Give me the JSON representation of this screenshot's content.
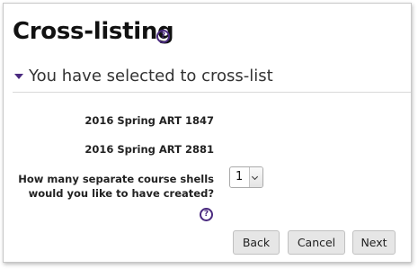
{
  "page": {
    "title": "Cross-listing",
    "title_help_icon": "question-circle-icon"
  },
  "section": {
    "title": "You have selected to cross-list",
    "toggle_icon": "caret-down-icon"
  },
  "selected_courses": [
    "2016 Spring ART 1847",
    "2016 Spring ART 2881"
  ],
  "shells_question": {
    "label": "How many separate course shells would you like to have created?",
    "help_icon": "question-circle-icon",
    "selected_value": "1"
  },
  "buttons": {
    "back": "Back",
    "cancel": "Cancel",
    "next": "Next"
  },
  "colors": {
    "accent": "#4a2a7f",
    "button_bg": "#e6e6e6",
    "divider": "#d9d9d9"
  }
}
